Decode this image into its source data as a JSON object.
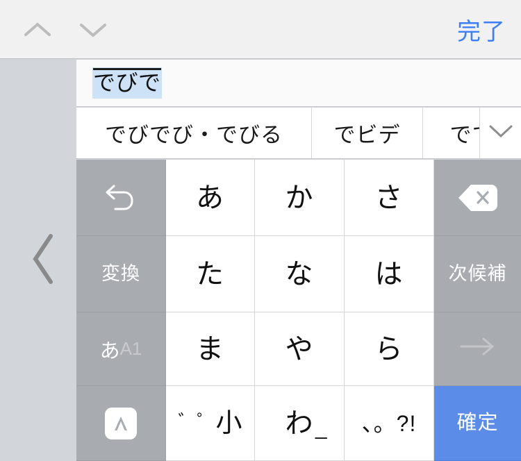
{
  "toolbar": {
    "prev_icon": "chevron-up-icon",
    "next_icon": "chevron-down-icon",
    "done_label": "完了"
  },
  "left_panel": {
    "collapse_icon": "chevron-left-icon"
  },
  "text_field": {
    "composing_text": "でびで",
    "highlight_color": "#CDE2F7"
  },
  "candidates": {
    "expand_icon": "chevron-down-icon",
    "items": [
      {
        "label": "でびでび・でびる"
      },
      {
        "label": "でビデ"
      },
      {
        "label": "でて"
      }
    ]
  },
  "keyboard": {
    "rows": [
      [
        {
          "name": "undo-key",
          "label": "",
          "icon": "undo-icon",
          "style": "gray"
        },
        {
          "name": "key-a",
          "label": "あ",
          "icon": "",
          "style": "white"
        },
        {
          "name": "key-ka",
          "label": "か",
          "icon": "",
          "style": "white"
        },
        {
          "name": "key-sa",
          "label": "さ",
          "icon": "",
          "style": "white"
        },
        {
          "name": "delete-key",
          "label": "",
          "icon": "backspace-icon",
          "style": "gray"
        }
      ],
      [
        {
          "name": "convert-key",
          "label": "変換",
          "icon": "",
          "style": "gray"
        },
        {
          "name": "key-ta",
          "label": "た",
          "icon": "",
          "style": "white"
        },
        {
          "name": "key-na",
          "label": "な",
          "icon": "",
          "style": "white"
        },
        {
          "name": "key-ha",
          "label": "は",
          "icon": "",
          "style": "white"
        },
        {
          "name": "next-candidate-key",
          "label": "次候補",
          "icon": "",
          "style": "gray"
        }
      ],
      [
        {
          "name": "input-mode-key",
          "label_primary": "あ",
          "label_secondary": "A1",
          "icon": "",
          "style": "gray"
        },
        {
          "name": "key-ma",
          "label": "ま",
          "icon": "",
          "style": "white"
        },
        {
          "name": "key-ya",
          "label": "や",
          "icon": "",
          "style": "white"
        },
        {
          "name": "key-ra",
          "label": "ら",
          "icon": "",
          "style": "white"
        },
        {
          "name": "cursor-right-key",
          "label": "",
          "icon": "arrow-right-icon",
          "style": "gray"
        }
      ],
      [
        {
          "name": "keyboard-switch-key",
          "label": "",
          "icon": "keyboard-switch-icon",
          "style": "gray"
        },
        {
          "name": "kana-modifier-key",
          "label_marks": "゛゜",
          "label_small": "小",
          "icon": "",
          "style": "white"
        },
        {
          "name": "key-wa",
          "label": "わ",
          "label_sub": "_",
          "icon": "",
          "style": "white"
        },
        {
          "name": "punctuation-key",
          "label": "、。?!",
          "icon": "",
          "style": "white"
        },
        {
          "name": "confirm-key",
          "label": "確定",
          "icon": "",
          "style": "blue"
        }
      ]
    ]
  },
  "colors": {
    "accent_blue": "#3B7EF5",
    "confirm_blue": "#5B8DE8",
    "key_gray": "#A8ABB0",
    "panel_gray": "#D2D6DB",
    "toolbar_gray": "#F1F1F1"
  }
}
